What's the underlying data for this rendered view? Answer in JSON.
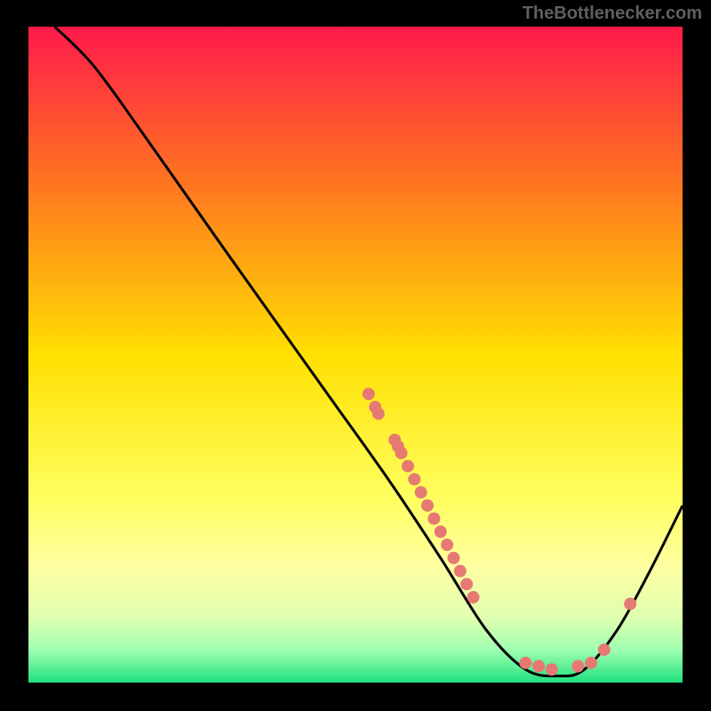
{
  "watermark": "TheBottlenecker.com",
  "chart_data": {
    "type": "line",
    "title": "",
    "xlabel": "",
    "ylabel": "",
    "xlim": [
      0,
      100
    ],
    "ylim": [
      0,
      100
    ],
    "gradient_stops": [
      {
        "offset": 0.0,
        "color": "#ff1a4a"
      },
      {
        "offset": 0.25,
        "color": "#ff7a1f"
      },
      {
        "offset": 0.5,
        "color": "#ffe000"
      },
      {
        "offset": 0.72,
        "color": "#ffff60"
      },
      {
        "offset": 0.82,
        "color": "#ffffa0"
      },
      {
        "offset": 0.9,
        "color": "#e0ffb0"
      },
      {
        "offset": 0.95,
        "color": "#a0ffb0"
      },
      {
        "offset": 1.0,
        "color": "#20e080"
      }
    ],
    "curve": [
      {
        "x": 4,
        "y": 100
      },
      {
        "x": 10,
        "y": 94
      },
      {
        "x": 18,
        "y": 83
      },
      {
        "x": 30,
        "y": 66
      },
      {
        "x": 45,
        "y": 45
      },
      {
        "x": 55,
        "y": 31
      },
      {
        "x": 63,
        "y": 19
      },
      {
        "x": 70,
        "y": 8
      },
      {
        "x": 76,
        "y": 2
      },
      {
        "x": 81,
        "y": 1
      },
      {
        "x": 85,
        "y": 2
      },
      {
        "x": 90,
        "y": 8
      },
      {
        "x": 95,
        "y": 17
      },
      {
        "x": 100,
        "y": 27
      }
    ],
    "scatter": [
      {
        "x": 52,
        "y": 44
      },
      {
        "x": 53,
        "y": 42
      },
      {
        "x": 53.5,
        "y": 41
      },
      {
        "x": 56,
        "y": 37
      },
      {
        "x": 56.5,
        "y": 36
      },
      {
        "x": 57,
        "y": 35
      },
      {
        "x": 58,
        "y": 33
      },
      {
        "x": 59,
        "y": 31
      },
      {
        "x": 60,
        "y": 29
      },
      {
        "x": 61,
        "y": 27
      },
      {
        "x": 62,
        "y": 25
      },
      {
        "x": 63,
        "y": 23
      },
      {
        "x": 64,
        "y": 21
      },
      {
        "x": 65,
        "y": 19
      },
      {
        "x": 66,
        "y": 17
      },
      {
        "x": 67,
        "y": 15
      },
      {
        "x": 68,
        "y": 13
      },
      {
        "x": 76,
        "y": 3
      },
      {
        "x": 78,
        "y": 2.5
      },
      {
        "x": 80,
        "y": 2
      },
      {
        "x": 84,
        "y": 2.5
      },
      {
        "x": 86,
        "y": 3
      },
      {
        "x": 88,
        "y": 5
      },
      {
        "x": 92,
        "y": 12
      }
    ],
    "marker_color": "#e67a73",
    "curve_color": "#000000"
  }
}
